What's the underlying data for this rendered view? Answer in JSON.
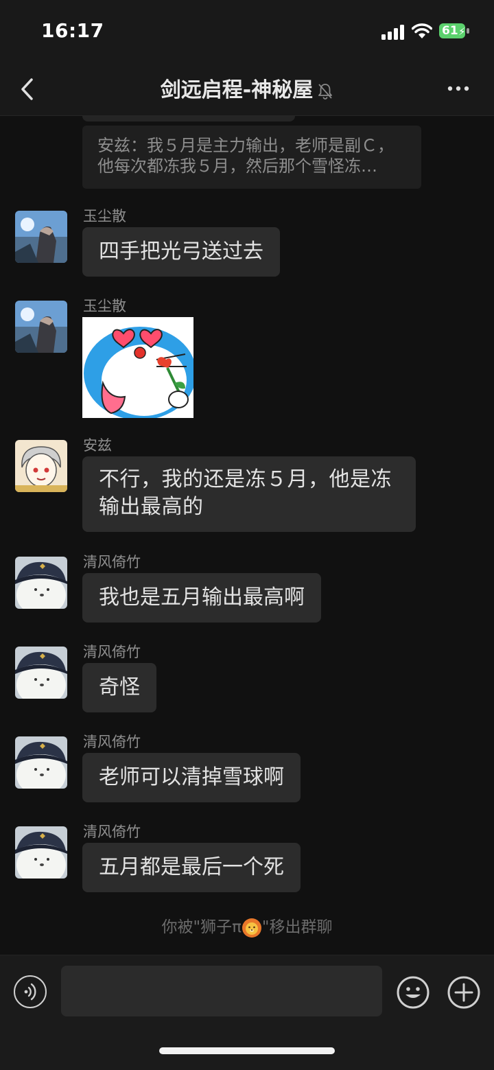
{
  "status_bar": {
    "time": "16:17",
    "battery_percent": "61",
    "battery_level": 0.61
  },
  "header": {
    "title": "剑远启程-神秘屋",
    "muted": true,
    "back_icon": "chevron-left-icon",
    "more_icon": "ellipsis-icon"
  },
  "quote": {
    "text": "安兹：我５月是主力输出，老师是副Ｃ，他每次都冻我５月，然后那个雪怪冻…"
  },
  "messages": [
    {
      "sender": "玉尘散",
      "avatar": "landscape-avatar",
      "type": "text",
      "text": "四手把光弓送过去"
    },
    {
      "sender": "玉尘散",
      "avatar": "landscape-avatar",
      "type": "sticker",
      "sticker": "doraemon-heart-eyes-rose-sticker"
    },
    {
      "sender": "安兹",
      "avatar": "anime-boy-avatar",
      "type": "text",
      "text": "不行，我的还是冻５月，他是冻输出最高的"
    },
    {
      "sender": "清风倚竹",
      "avatar": "bear-in-cap-avatar",
      "type": "text",
      "text": "我也是五月输出最高啊"
    },
    {
      "sender": "清风倚竹",
      "avatar": "bear-in-cap-avatar",
      "type": "text",
      "text": "奇怪"
    },
    {
      "sender": "清风倚竹",
      "avatar": "bear-in-cap-avatar",
      "type": "text",
      "text": "老师可以清掉雪球啊"
    },
    {
      "sender": "清风倚竹",
      "avatar": "bear-in-cap-avatar",
      "type": "text",
      "text": "五月都是最后一个死"
    }
  ],
  "system_notice": {
    "before": "你被\"狮子π",
    "emoji": "lion-face-icon",
    "after": "\"移出群聊"
  },
  "input_bar": {
    "voice_icon": "voice-icon",
    "input_value": "",
    "emoji_icon": "smiley-icon",
    "add_icon": "plus-circle-icon"
  },
  "colors": {
    "background": "#111111",
    "bar": "#191919",
    "bubble": "#2c2c2c",
    "battery": "#5bd16d"
  }
}
